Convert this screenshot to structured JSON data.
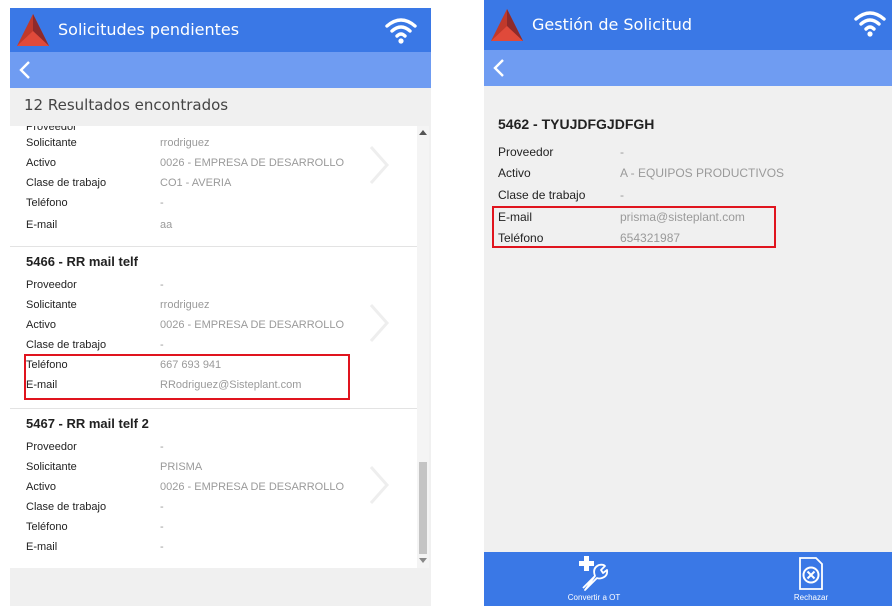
{
  "left": {
    "header_title": "Solicitudes pendientes",
    "results": "12 Resultados encontrados",
    "cards": [
      {
        "title": "",
        "fields": [
          {
            "label": "Proveedor",
            "value": ""
          },
          {
            "label": "Solicitante",
            "value": "rrodriguez"
          },
          {
            "label": "Activo",
            "value": "0026 - EMPRESA DE DESARROLLO"
          },
          {
            "label": "Clase de trabajo",
            "value": "CO1 - AVERIA"
          },
          {
            "label": "Teléfono",
            "value": "-"
          },
          {
            "label": "E-mail",
            "value": "aa"
          }
        ]
      },
      {
        "title": "5466 - RR mail telf",
        "fields": [
          {
            "label": "Proveedor",
            "value": "-"
          },
          {
            "label": "Solicitante",
            "value": "rrodriguez"
          },
          {
            "label": "Activo",
            "value": "0026 - EMPRESA DE DESARROLLO"
          },
          {
            "label": "Clase de trabajo",
            "value": "-"
          },
          {
            "label": "Teléfono",
            "value": "667 693 941"
          },
          {
            "label": "E-mail",
            "value": "RRodriguez@Sisteplant.com"
          }
        ]
      },
      {
        "title": "5467 - RR mail telf 2",
        "fields": [
          {
            "label": "Proveedor",
            "value": "-"
          },
          {
            "label": "Solicitante",
            "value": "PRISMA"
          },
          {
            "label": "Activo",
            "value": "0026 - EMPRESA DE DESARROLLO"
          },
          {
            "label": "Clase de trabajo",
            "value": "-"
          },
          {
            "label": "Teléfono",
            "value": "-"
          },
          {
            "label": "E-mail",
            "value": "-"
          }
        ]
      }
    ]
  },
  "right": {
    "header_title": "Gestión de Solicitud",
    "request_title": "5462 - TYUJDFGJDFGH",
    "fields": [
      {
        "label": "Proveedor",
        "value": "-"
      },
      {
        "label": "Activo",
        "value": "A - EQUIPOS PRODUCTIVOS"
      },
      {
        "label": "Clase de trabajo",
        "value": "-"
      },
      {
        "label": "E-mail",
        "value": "prisma@sisteplant.com"
      },
      {
        "label": "Teléfono",
        "value": "654321987"
      }
    ],
    "actions": {
      "convert_label": "Convertir a OT",
      "reject_label": "Rechazar"
    }
  },
  "colors": {
    "header": "#3a78e6",
    "subbar": "#6f9cf2",
    "highlight": "#e0141e"
  },
  "icons": [
    "logo-icon",
    "wifi-icon",
    "back-icon",
    "chevron-right-icon",
    "wrench-plus-icon",
    "reject-document-icon"
  ]
}
